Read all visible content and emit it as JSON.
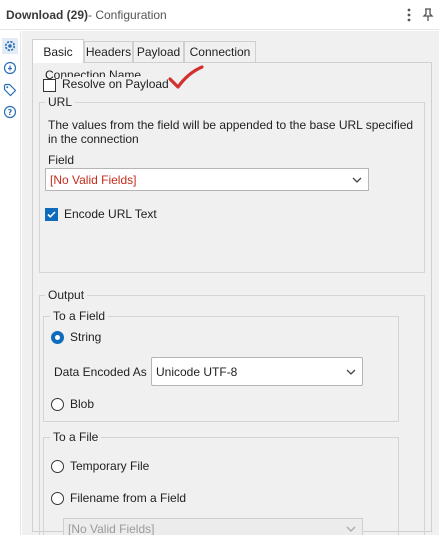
{
  "window": {
    "title": "Download (29)",
    "subtitle": "- Configuration",
    "more_icon": "more-vertical-icon",
    "pin_icon": "pin-icon"
  },
  "sidebar": {
    "items": [
      {
        "icon": "gear-icon",
        "active": true
      },
      {
        "icon": "settings-circle-icon",
        "active": false
      },
      {
        "icon": "tag-icon",
        "active": false
      },
      {
        "icon": "help-icon",
        "active": false
      }
    ]
  },
  "tabs": [
    {
      "label": "Basic",
      "active": true
    },
    {
      "label": "Headers",
      "active": false
    },
    {
      "label": "Payload",
      "active": false
    },
    {
      "label": "Connection",
      "active": false
    }
  ],
  "basic": {
    "connection_name_label": "Connection Name",
    "resolve_on_payload": {
      "label": "Resolve on Payload",
      "checked": false
    },
    "url": {
      "group_label": "URL",
      "description": "The values from the field will be appended to the base URL specified in the connection",
      "field_label": "Field",
      "field_value": "[No Valid Fields]",
      "encode_url_text": {
        "label": "Encode URL Text",
        "checked": true
      }
    },
    "output": {
      "group_label": "Output",
      "to_a_field": {
        "group_label": "To a Field",
        "string_label": "String",
        "string_checked": true,
        "data_encoded_as_label": "Data Encoded As",
        "data_encoded_as_value": "Unicode UTF-8",
        "blob_label": "Blob",
        "blob_checked": false
      },
      "to_a_file": {
        "group_label": "To a File",
        "temporary_file_label": "Temporary File",
        "temporary_file_checked": false,
        "filename_from_field_label": "Filename from a Field",
        "filename_from_field_checked": false,
        "filename_field_value": "[No Valid Fields]"
      }
    }
  },
  "colors": {
    "accent": "#0f6cbd",
    "error_text": "#c42b1c",
    "annotation": "#d32f2f"
  }
}
